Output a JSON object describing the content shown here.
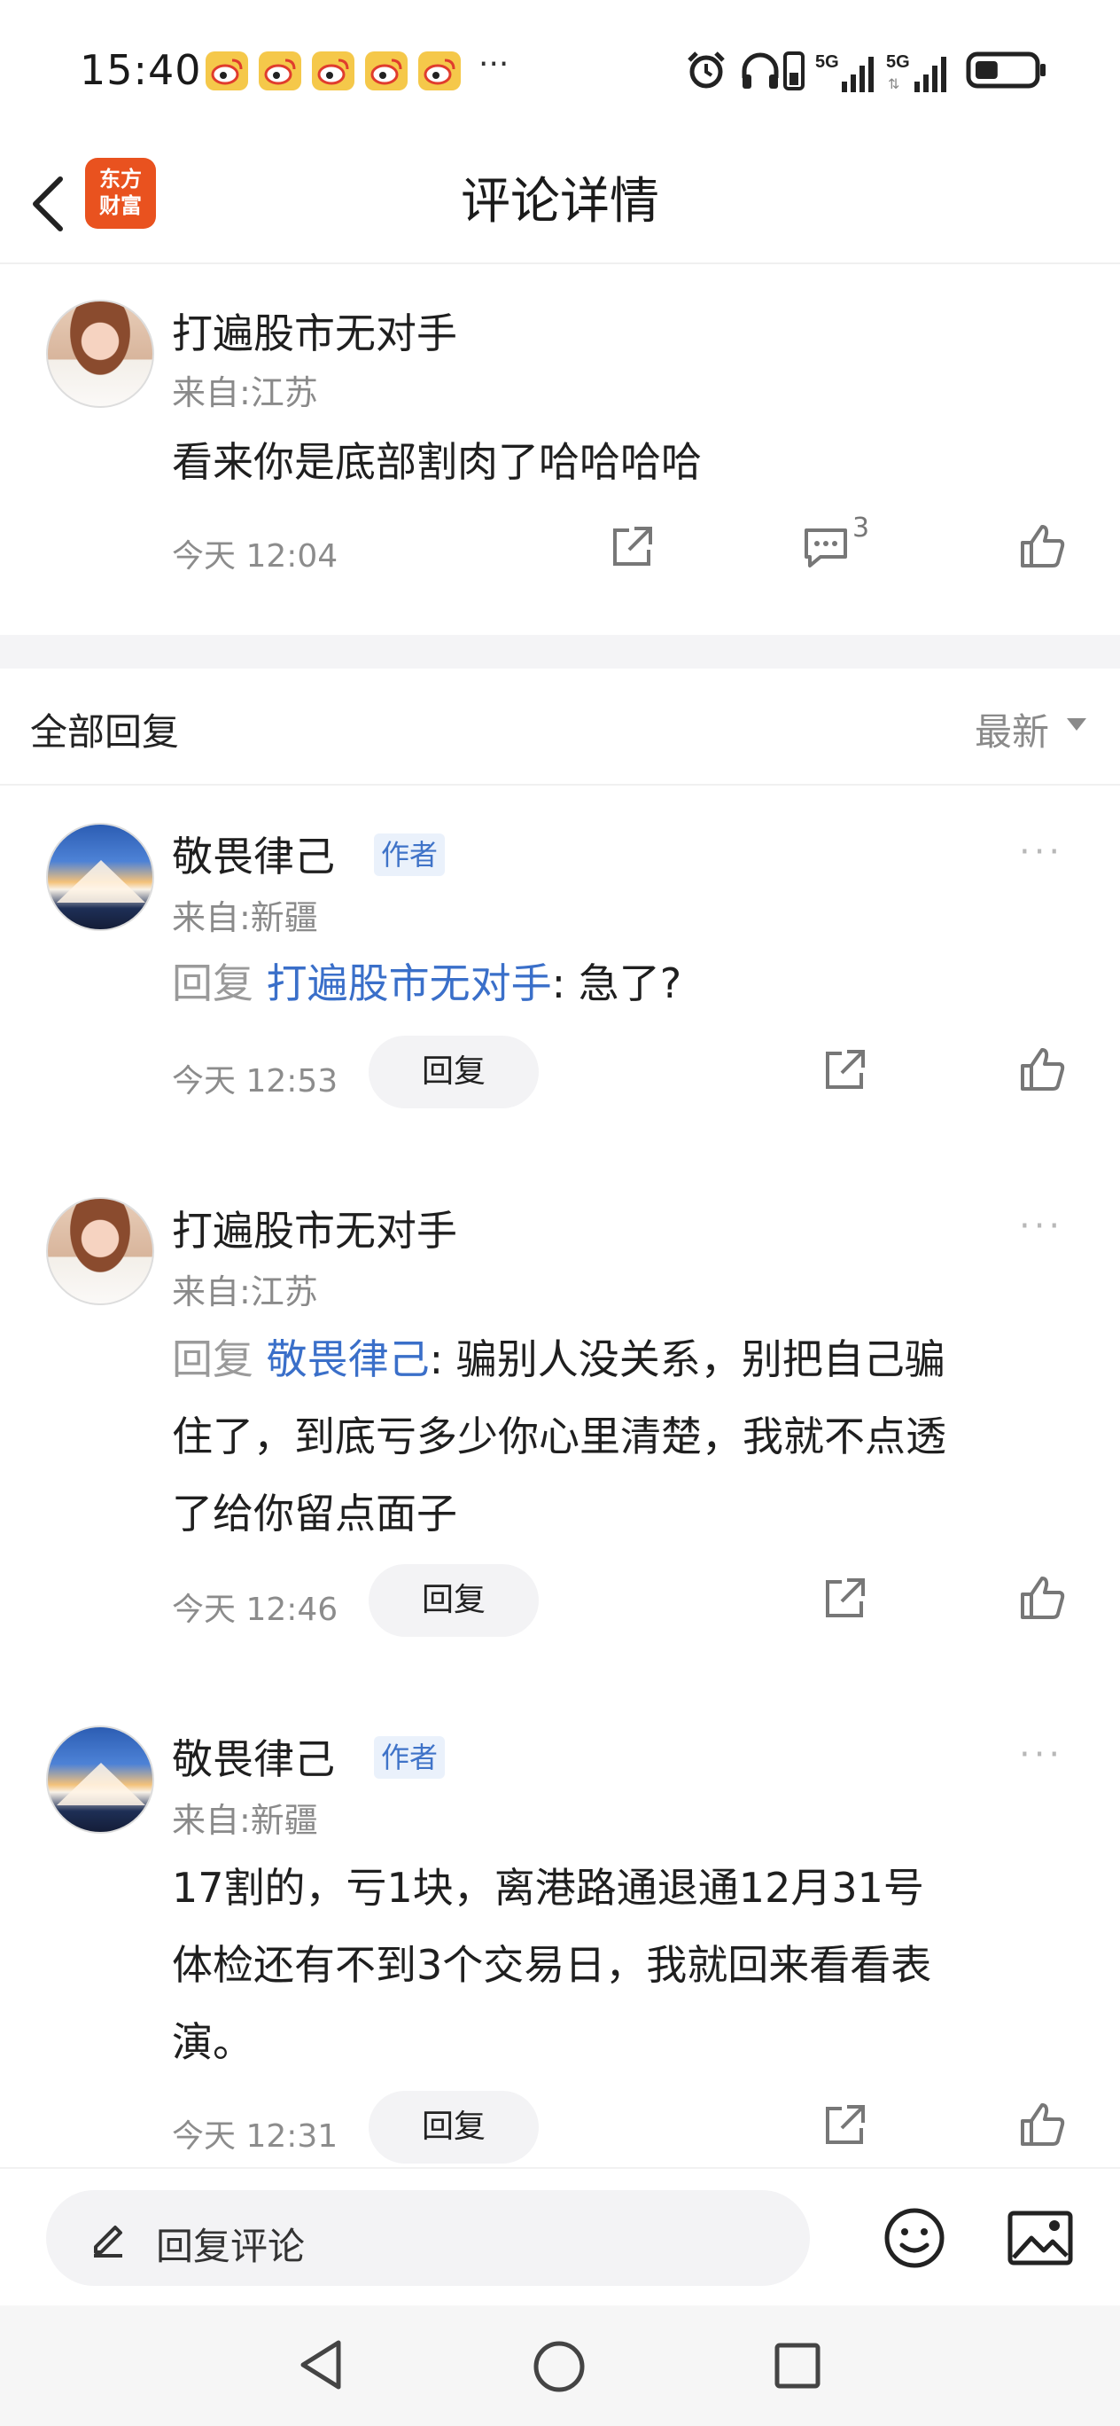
{
  "status_bar": {
    "time": "15:40",
    "more": "···",
    "battery_level": 0.4
  },
  "header": {
    "title": "评论详情",
    "logo_text": "东方\n财富"
  },
  "main_comment": {
    "name": "打遍股市无对手",
    "from": "来自:江苏",
    "content": "看来你是底部割肉了哈哈哈哈",
    "time": "今天 12:04",
    "reply_count": "3"
  },
  "section": {
    "title": "全部回复",
    "sort": "最新"
  },
  "replies": [
    {
      "name": "敬畏律己",
      "author_tag": "作者",
      "from": "来自:新疆",
      "reply_prefix": "回复",
      "reply_to": "打遍股市无对手",
      "text": ": 急了?",
      "time": "今天 12:53",
      "reply_btn": "回复"
    },
    {
      "name": "打遍股市无对手",
      "from": "来自:江苏",
      "reply_prefix": "回复",
      "reply_to": "敬畏律己",
      "text_line1": ": 骗别人没关系，别把自己骗",
      "text_line2": "住了，到底亏多少你心里清楚，我就不点透",
      "text_line3": "了给你留点面子",
      "time": "今天 12:46",
      "reply_btn": "回复"
    },
    {
      "name": "敬畏律己",
      "author_tag": "作者",
      "from": "来自:新疆",
      "text_line1": "17割的，亏1块，离港路通退通12月31号",
      "text_line2": "体检还有不到3个交易日，我就回来看看表",
      "text_line3": "演。",
      "time": "今天 12:31",
      "reply_btn": "回复"
    }
  ],
  "input": {
    "placeholder": "回复评论"
  }
}
